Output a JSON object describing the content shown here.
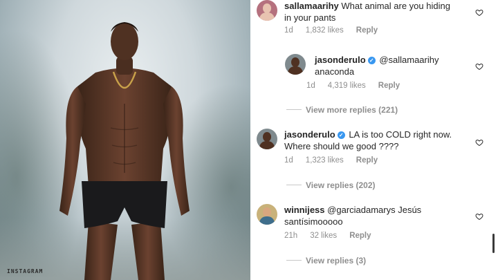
{
  "photo": {
    "watermark": "INSTAGRAM"
  },
  "comments": [
    {
      "username": "sallamaarihy",
      "verified": false,
      "text_line1": "What animal are you hiding",
      "text_line2": "in your pants",
      "age": "1d",
      "likes": "1,832 likes",
      "reply_label": "Reply"
    },
    {
      "username": "jasonderulo",
      "verified": true,
      "text_line1": "@sallamaarihy",
      "text_line2": "anaconda",
      "age": "1d",
      "likes": "4,319 likes",
      "reply_label": "Reply"
    },
    {
      "username": "jasonderulo",
      "verified": true,
      "text_line1": "LA is too COLD right now.",
      "text_line2": "Where should we good ????",
      "age": "1d",
      "likes": "1,323 likes",
      "reply_label": "Reply"
    },
    {
      "username": "winnijess",
      "verified": false,
      "text_line1": "@garciadamarys Jesús",
      "text_line2": "santísimooooo",
      "age": "21h",
      "likes": "32 likes",
      "reply_label": "Reply"
    }
  ],
  "view_more_replies": "View more replies (221)",
  "view_replies_1": "View replies (202)",
  "view_replies_2": "View replies (3)",
  "icons": {
    "like": "heart-outline-icon",
    "verified": "verified-badge-icon"
  },
  "colors": {
    "verified": "#3897f0",
    "meta_text": "#8e8e8e",
    "text": "#262626"
  }
}
